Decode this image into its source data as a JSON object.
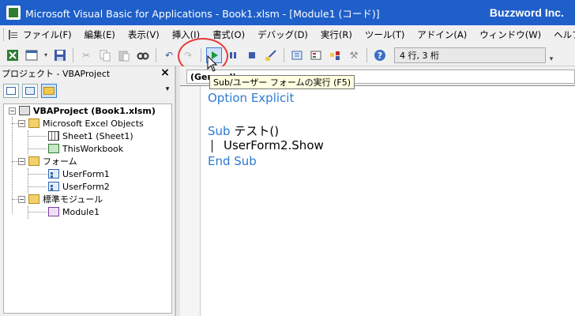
{
  "window": {
    "title": "Microsoft Visual Basic for Applications - Book1.xlsm - [Module1 (コード)]",
    "brand": "Buzzword Inc."
  },
  "menu": [
    "ファイル(F)",
    "編集(E)",
    "表示(V)",
    "挿入(I)",
    "書式(O)",
    "デバッグ(D)",
    "実行(R)",
    "ツール(T)",
    "アドイン(A)",
    "ウィンドウ(W)",
    "ヘルプ(H)"
  ],
  "toolbar": {
    "position_readout": "4 行, 3 桁",
    "run_tooltip": "Sub/ユーザー フォームの実行 (F5)"
  },
  "project_panel": {
    "title": "プロジェクト - VBAProject",
    "close_label": "×",
    "tree": {
      "root": "VBAProject (Book1.xlsm)",
      "excel_objects": "Microsoft Excel Objects",
      "sheet1": "Sheet1 (Sheet1)",
      "thisworkbook": "ThisWorkbook",
      "forms": "フォーム",
      "userform1": "UserForm1",
      "userform2": "UserForm2",
      "modules": "標準モジュール",
      "module1": "Module1"
    }
  },
  "code": {
    "proc_combo": "(General)",
    "option_kw": "Option Explicit",
    "sub_kw": "Sub",
    "sub_name": "テスト()",
    "body": "UserForm2.Show",
    "end_sub": "End Sub"
  },
  "colors": {
    "titlebar": "#1f5fc9",
    "keyword": "#2c7bd0",
    "highlight_circle": "#e53935"
  }
}
